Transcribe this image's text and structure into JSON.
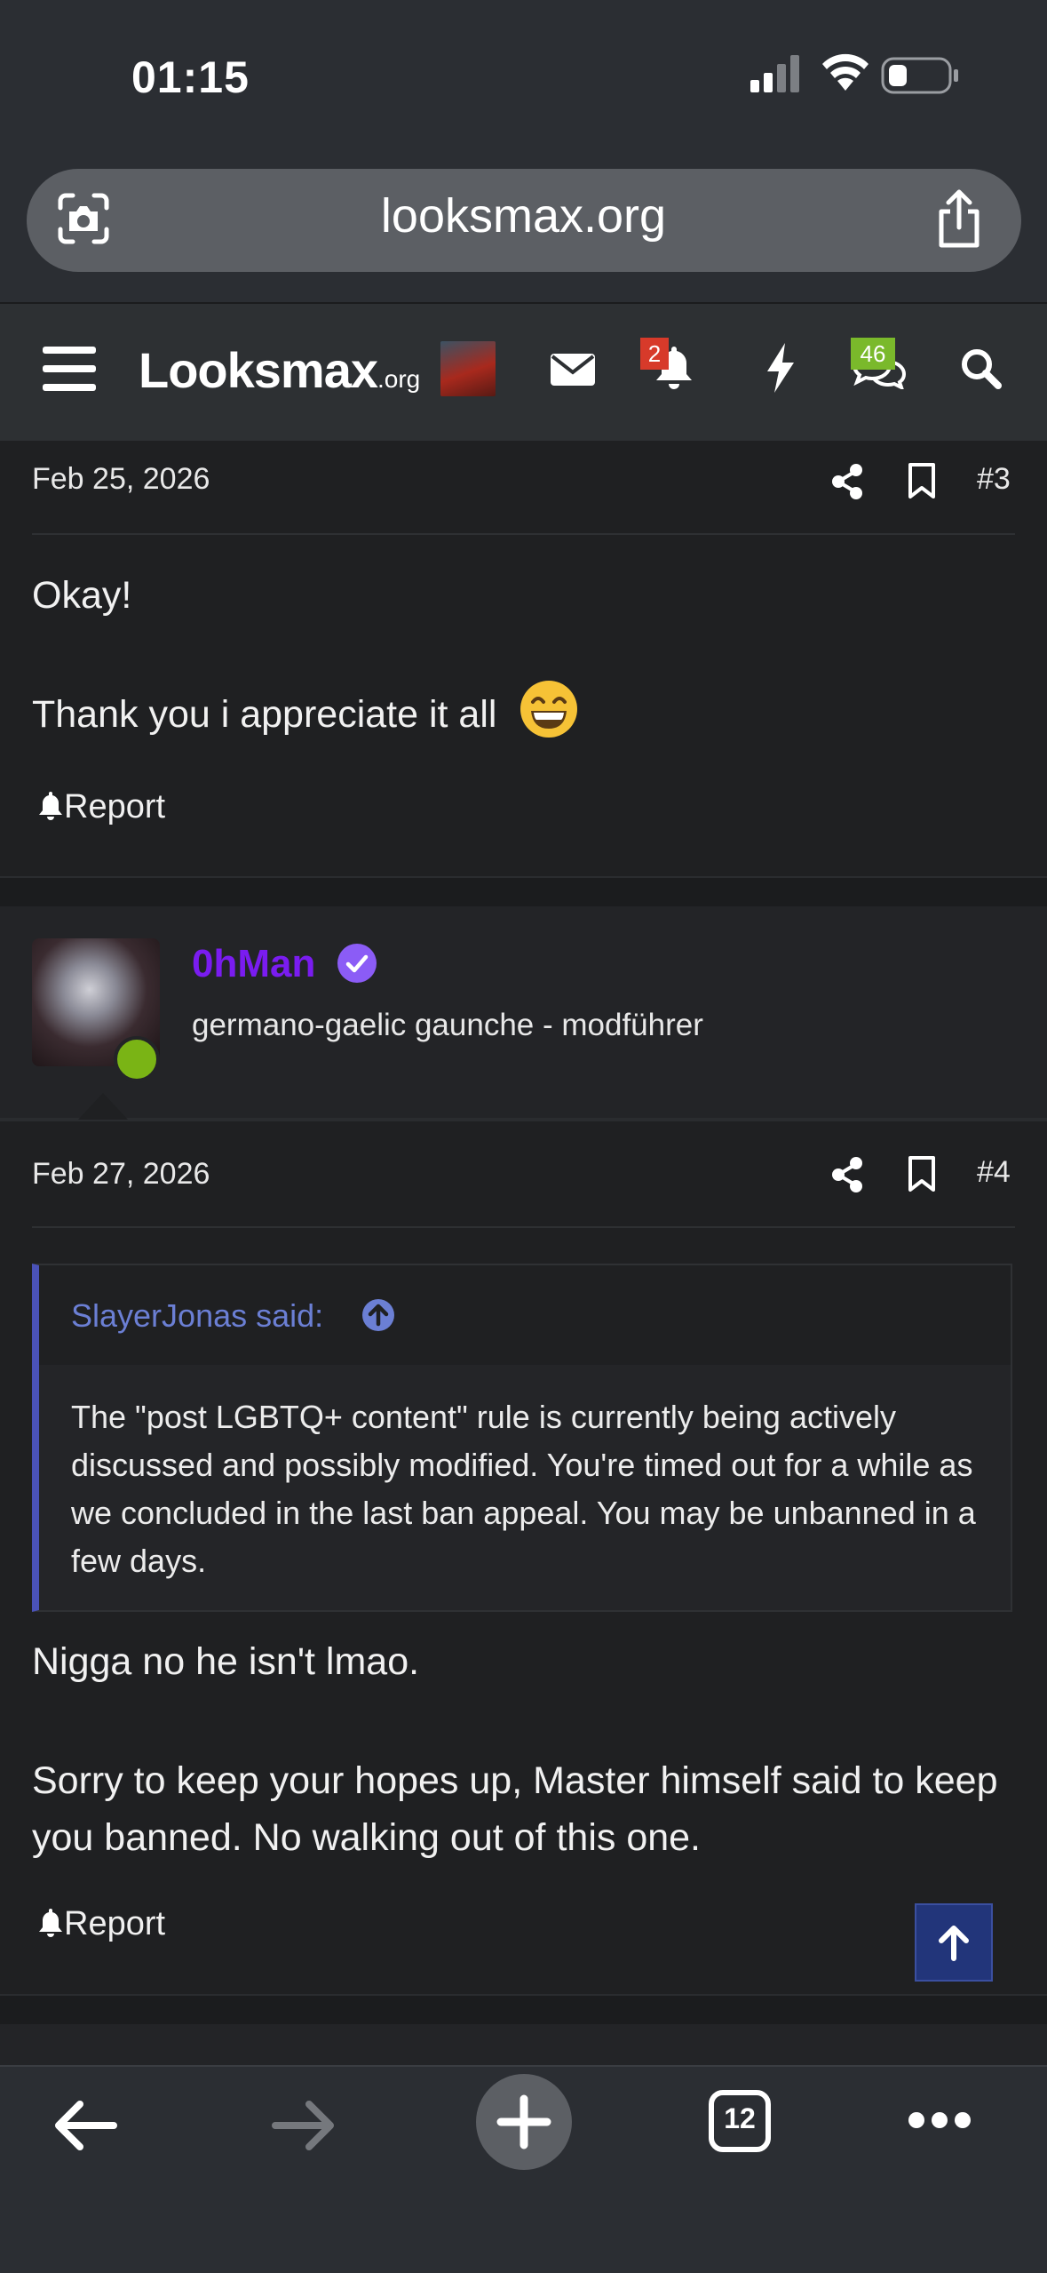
{
  "status_bar": {
    "time": "01:15"
  },
  "browser": {
    "url": "looksmax.org",
    "open_tabs": "12"
  },
  "site_nav": {
    "logo_main": "Looksmax",
    "logo_suffix": ".org",
    "notifications_count": "2",
    "conversations_count": "46"
  },
  "posts": [
    {
      "date": "Feb 25, 2026",
      "number": "#3",
      "lines": [
        "Okay!",
        "Thank you i appreciate it all"
      ],
      "emoji": "😁",
      "report_label": "Report"
    },
    {
      "author": {
        "name": "0hMan",
        "title": "germano-gaelic gaunche - modführer",
        "online": true
      },
      "date": "Feb 27, 2026",
      "number": "#4",
      "quote": {
        "author_label": "SlayerJonas said:",
        "text": "The \"post LGBTQ+ content\" rule is currently being actively discussed and possibly modified. You're timed out for a while as we concluded in the last ban appeal. You may be unbanned in a few days."
      },
      "lines": [
        "Nigga no he isn't lmao.",
        "Sorry to keep your hopes up, Master himself said to keep you banned. No walking out of this one."
      ],
      "report_label": "Report"
    }
  ],
  "colors": {
    "username": "#7a1cf0",
    "quote_author": "#6b7fd4",
    "quote_bar": "#4a52b8",
    "alert_badge": "#d73a2a",
    "conversation_badge": "#7ab92b",
    "online": "#7ab415",
    "scroll_top_button": "#22357a"
  },
  "icons": [
    "lens-icon",
    "share-icon",
    "hamburger-icon",
    "mail-icon",
    "bell-icon",
    "bolt-icon",
    "chat-icon",
    "search-icon",
    "bookmark-icon",
    "verified-icon",
    "arrow-up-circle-icon",
    "arrow-up-icon",
    "back-arrow-icon",
    "forward-arrow-icon",
    "plus-icon",
    "more-icon"
  ]
}
